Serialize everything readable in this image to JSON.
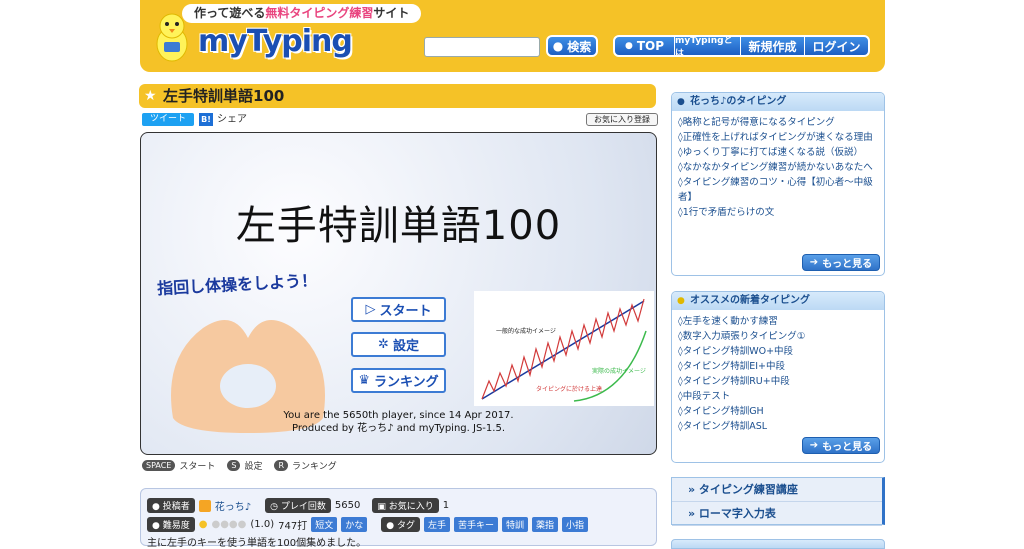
{
  "header": {
    "tagline_prefix": "作って遊べる",
    "tagline_highlight": "無料タイピング練習",
    "tagline_suffix": "サイト",
    "logo": "myTyping",
    "search_value": "",
    "search_button": "検索",
    "nav": [
      "TOP",
      "myTypingとは",
      "新規作成",
      "ログイン"
    ]
  },
  "page": {
    "title": "左手特訓単語100",
    "tweet": "ツイート",
    "hatena": "B!",
    "share": "シェア",
    "favorite": "お気に入り登録"
  },
  "game": {
    "title": "左手特訓単語100",
    "subtitle": "指回し体操をしよう！",
    "start": "スタート",
    "settings": "設定",
    "ranking": "ランキング",
    "info_line1": "You are the 5650th player, since 14 Apr 2017.",
    "info_line2": "Produced by 花っち♪ and myTyping. JS-1.5.",
    "graph_label_general": "一般的な成功イメージ",
    "graph_label_real": "実際の成功イメージ",
    "graph_label_typing": "タイピングに於ける上達"
  },
  "key_hints": [
    {
      "key": "SPACE",
      "label": "スタート"
    },
    {
      "key": "S",
      "label": "設定"
    },
    {
      "key": "R",
      "label": "ランキング"
    }
  ],
  "meta": {
    "poster_label": "投稿者",
    "poster": "花っち♪",
    "plays_label": "プレイ回数",
    "plays": "5650",
    "fav_label": "お気に入り",
    "fav": "1",
    "difficulty_label": "難易度",
    "difficulty": "(1.0)",
    "keys": "747打",
    "kind_tags": [
      "短文",
      "かな"
    ],
    "tag_label": "タグ",
    "tags": [
      "左手",
      "苦手キー",
      "特訓",
      "薬指",
      "小指"
    ],
    "description": "主に左手のキーを使う単語を100個集めました。"
  },
  "sidebar": {
    "box1": {
      "title": "花っち♪のタイピング",
      "items": [
        "◊略称と記号が得意になるタイピング",
        "◊正確性を上げればタイピングが速くなる理由",
        "◊ゆっくり丁寧に打てば速くなる説（仮説）",
        "◊なかなかタイピング練習が続かないあなたへ",
        "◊タイピング練習のコツ・心得【初心者～中級者】",
        "◊1行で矛盾だらけの文"
      ],
      "more": "もっと見る"
    },
    "box2": {
      "title": "オススメの新着タイピング",
      "items": [
        "◊左手を速く動かす練習",
        "◊数字入力頑張りタイピング①",
        "◊タイピング特訓WO+中段",
        "◊タイピング特訓EI+中段",
        "◊タイピング特訓RU+中段",
        "◊中段テスト",
        "◊タイピング特訓GH",
        "◊タイピング特訓ASL"
      ],
      "more": "もっと見る"
    },
    "links": [
      "» タイピング練習講座",
      "» ローマ字入力表"
    ]
  }
}
